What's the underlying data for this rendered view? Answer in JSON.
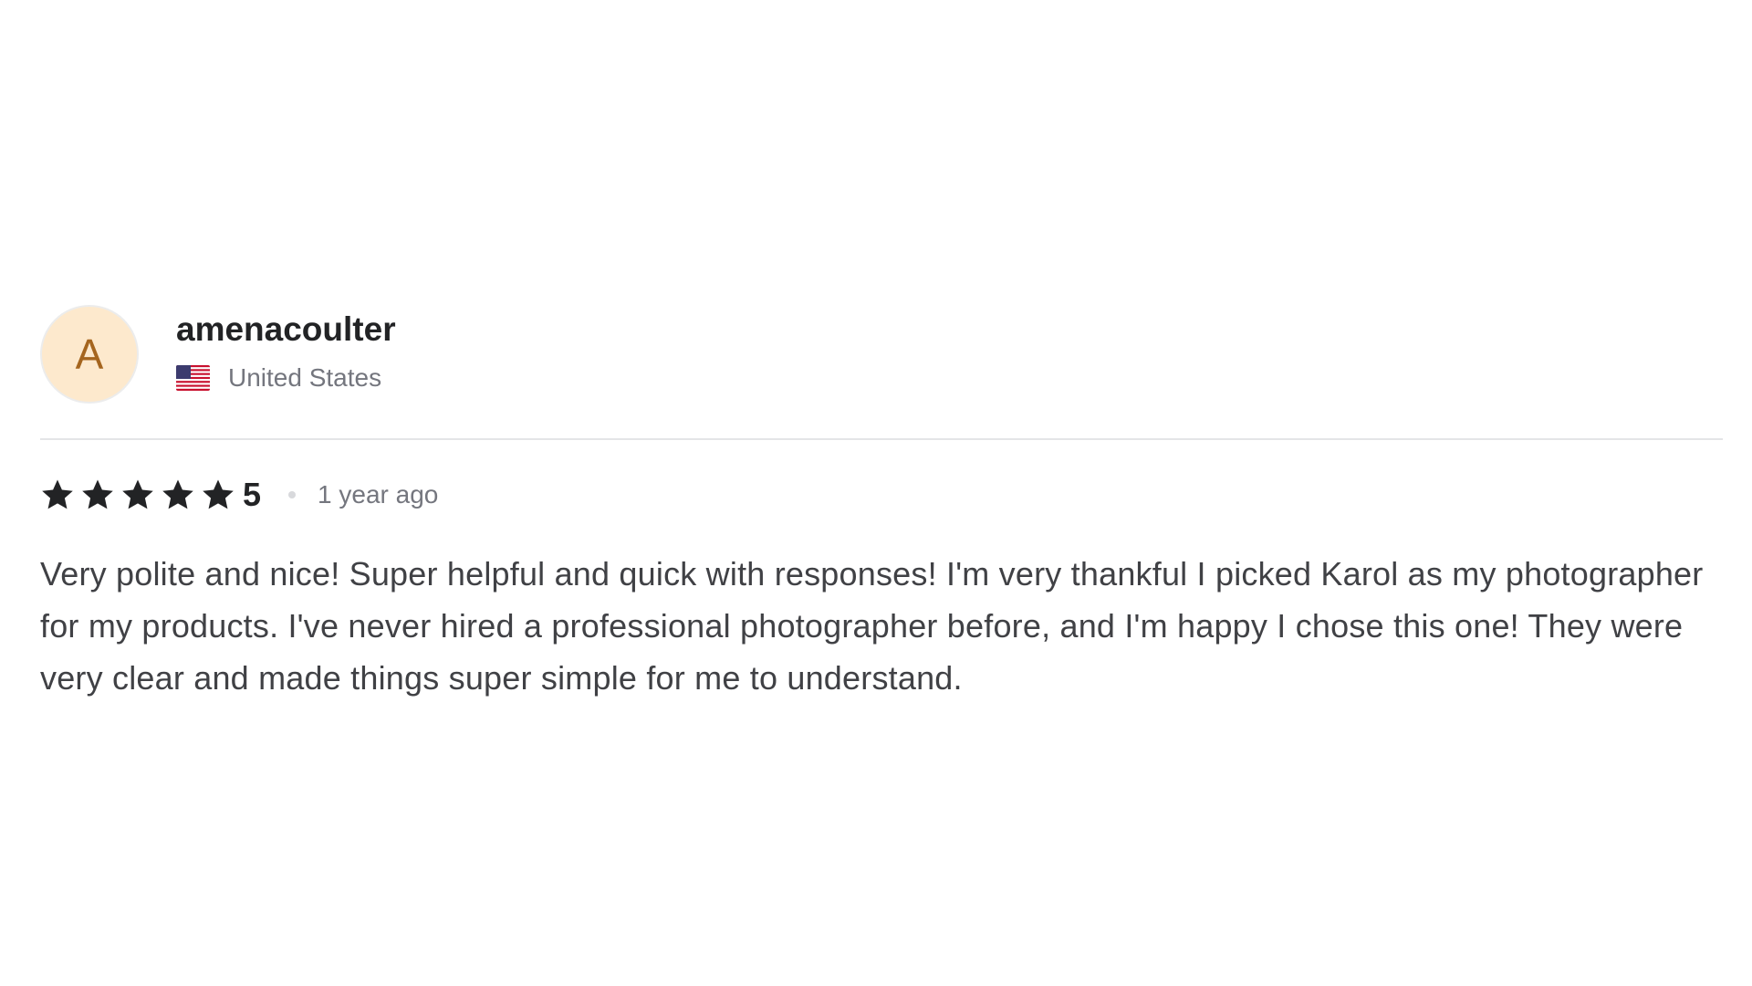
{
  "review": {
    "avatar_initial": "A",
    "username": "amenacoulter",
    "country": "United States",
    "flag_icon": "us-flag-icon",
    "rating": {
      "stars": 5,
      "value_label": "5"
    },
    "time_ago": "1 year ago",
    "text": "Very polite and nice! Super helpful and quick with responses! I'm very thankful I picked Karol as my photographer for my products. I've never hired a professional photographer before, and I'm happy I chose this one! They were very clear and made things super simple for me to understand."
  },
  "colors": {
    "avatar_bg": "#fde9cd",
    "avatar_text": "#a5651e",
    "star": "#222325",
    "muted_text": "#74767e",
    "body_text": "#404145"
  }
}
